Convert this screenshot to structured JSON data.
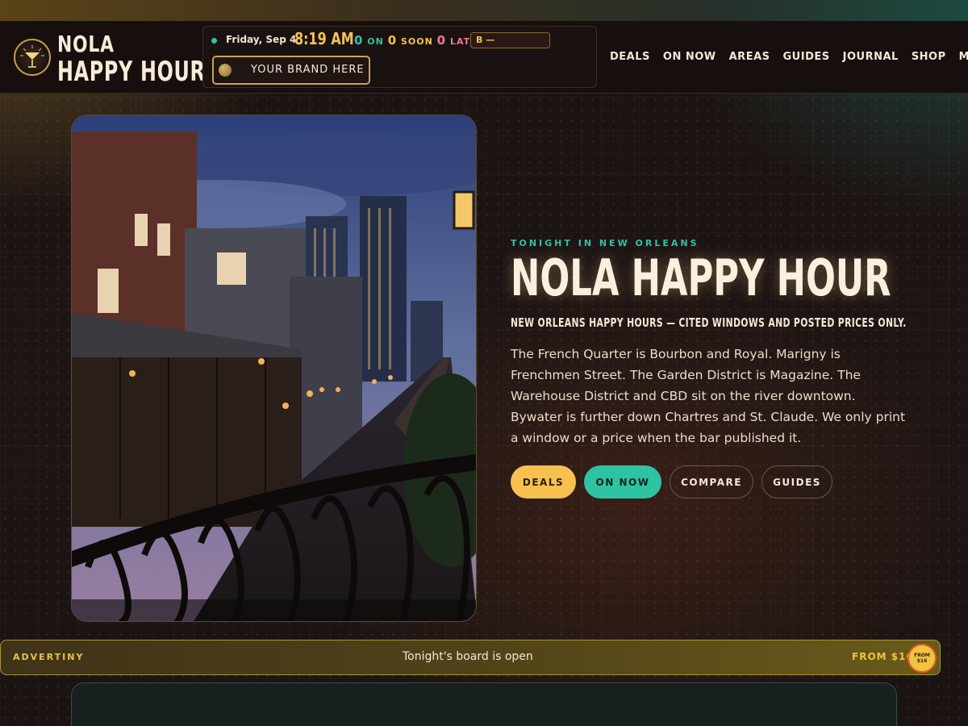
{
  "brand": {
    "line1": "NOLA",
    "line2": "HAPPY HOUR",
    "logo_icon": "cocktail-glass-icon"
  },
  "status": {
    "date": "Friday, Sep 4",
    "time": "8:19 AM",
    "on_count": "0",
    "on_label": "ON",
    "soon_count": "0",
    "soon_label": "SOON",
    "late_count": "0",
    "late_label": "LATE",
    "ticker": "B —",
    "brand_button": "YOUR BRAND HERE"
  },
  "nav": [
    "DEALS",
    "ON NOW",
    "AREAS",
    "GUIDES",
    "JOURNAL",
    "SHOP",
    "MORE"
  ],
  "hero": {
    "kicker": "TONIGHT IN NEW ORLEANS",
    "title": "NOLA HAPPY HOUR",
    "subtitle": "NEW ORLEANS HAPPY HOURS — CITED WINDOWS AND POSTED PRICES ONLY.",
    "description": "The French Quarter is Bourbon and Royal. Marigny is Frenchmen Street. The Garden District is Magazine. The Warehouse District and CBD sit on the river downtown. Bywater is further down Chartres and St. Claude. We only print a window or a price when the bar published it.",
    "photo_subject": "french-quarter-balcony-night-photo",
    "buttons": {
      "deals": "DEALS",
      "on_now": "ON NOW",
      "compare": "COMPARE",
      "guides": "GUIDES"
    }
  },
  "ad": {
    "label": "ADVERTINY",
    "text": "Tonight's board is open",
    "price": "FROM $16",
    "sticker": "FROM $16"
  },
  "colors": {
    "gold": "#f6c14f",
    "teal": "#2ec3a3",
    "pink": "#f07a8a",
    "background": "#1d1514"
  }
}
